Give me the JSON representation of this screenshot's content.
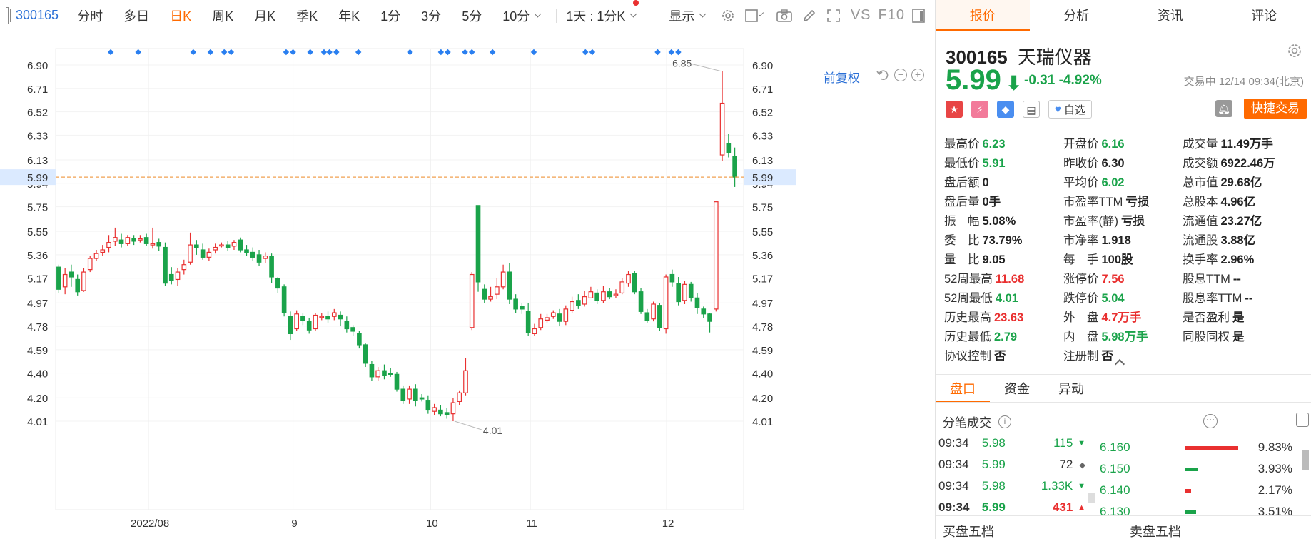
{
  "toolbar": {
    "code": "300165",
    "periods": [
      "分时",
      "多日",
      "日K",
      "周K",
      "月K",
      "季K",
      "年K",
      "1分",
      "3分",
      "5分"
    ],
    "active_period": "日K",
    "interval_select": "10分",
    "combo_select": "1天 : 1分K",
    "display_label": "显示",
    "vs_label": "VS",
    "f10_label": "F10"
  },
  "chart": {
    "adjust_label": "前复权",
    "reset_icon": "undo-icon",
    "zoom_out_icon": "minus-icon",
    "zoom_in_icon": "plus-icon",
    "current_price_label": "5.99",
    "high_label": "6.85",
    "low_label": "4.01",
    "x_labels": [
      "2022/08",
      "9",
      "10",
      "11",
      "12"
    ],
    "y_labels": [
      "6.90",
      "6.71",
      "6.52",
      "6.33",
      "6.13",
      "5.94",
      "5.75",
      "5.55",
      "5.36",
      "5.17",
      "4.97",
      "4.78",
      "4.59",
      "4.40",
      "4.20",
      "4.01"
    ]
  },
  "chart_data": {
    "type": "candlestick",
    "y_axis": {
      "ticks": [
        6.9,
        6.71,
        6.52,
        6.33,
        6.13,
        5.94,
        5.75,
        5.55,
        5.36,
        5.17,
        4.97,
        4.78,
        4.59,
        4.4,
        4.2,
        4.01
      ],
      "range": [
        4.01,
        6.9
      ]
    },
    "x_labels": [
      "2022/08",
      "9",
      "10",
      "11",
      "12"
    ],
    "current_price": 5.99,
    "max_label": 6.85,
    "min_label": 4.01,
    "candles": [
      [
        5.26,
        5.08,
        5.28,
        5.05
      ],
      [
        5.1,
        5.2,
        5.25,
        5.04
      ],
      [
        5.22,
        5.18,
        5.28,
        5.1
      ],
      [
        5.16,
        5.06,
        5.2,
        5.03
      ],
      [
        5.07,
        5.22,
        5.25,
        5.06
      ],
      [
        5.24,
        5.33,
        5.35,
        5.22
      ],
      [
        5.33,
        5.37,
        5.4,
        5.31
      ],
      [
        5.38,
        5.4,
        5.44,
        5.35
      ],
      [
        5.42,
        5.46,
        5.52,
        5.38
      ],
      [
        5.47,
        5.5,
        5.58,
        5.43
      ],
      [
        5.48,
        5.45,
        5.53,
        5.42
      ],
      [
        5.45,
        5.5,
        5.52,
        5.43
      ],
      [
        5.49,
        5.47,
        5.52,
        5.44
      ],
      [
        5.48,
        5.49,
        5.52,
        5.46
      ],
      [
        5.5,
        5.45,
        5.53,
        5.43
      ],
      [
        5.44,
        5.45,
        5.58,
        5.41
      ],
      [
        5.46,
        5.43,
        5.49,
        5.39
      ],
      [
        5.42,
        5.13,
        5.46,
        5.11
      ],
      [
        5.2,
        5.15,
        5.26,
        5.12
      ],
      [
        5.16,
        5.22,
        5.25,
        5.11
      ],
      [
        5.24,
        5.28,
        5.32,
        5.2
      ],
      [
        5.3,
        5.44,
        5.54,
        5.28
      ],
      [
        5.44,
        5.42,
        5.48,
        5.36
      ],
      [
        5.4,
        5.34,
        5.45,
        5.32
      ],
      [
        5.34,
        5.38,
        5.41,
        5.31
      ],
      [
        5.4,
        5.42,
        5.45,
        5.37
      ],
      [
        5.44,
        5.44,
        5.46,
        5.42
      ],
      [
        5.44,
        5.42,
        5.47,
        5.39
      ],
      [
        5.43,
        5.46,
        5.48,
        5.4
      ],
      [
        5.48,
        5.4,
        5.5,
        5.38
      ],
      [
        5.4,
        5.38,
        5.44,
        5.35
      ],
      [
        5.38,
        5.34,
        5.42,
        5.31
      ],
      [
        5.36,
        5.3,
        5.4,
        5.27
      ],
      [
        5.33,
        5.35,
        5.38,
        5.29
      ],
      [
        5.35,
        5.18,
        5.37,
        5.13
      ],
      [
        5.17,
        5.09,
        5.18,
        5.05
      ],
      [
        5.1,
        4.89,
        5.12,
        4.86
      ],
      [
        4.86,
        4.72,
        4.9,
        4.67
      ],
      [
        4.76,
        4.88,
        4.91,
        4.74
      ],
      [
        4.86,
        4.83,
        4.89,
        4.79
      ],
      [
        4.82,
        4.75,
        4.85,
        4.72
      ],
      [
        4.76,
        4.87,
        4.89,
        4.74
      ],
      [
        4.86,
        4.86,
        4.89,
        4.83
      ],
      [
        4.86,
        4.84,
        4.9,
        4.81
      ],
      [
        4.86,
        4.89,
        4.92,
        4.83
      ],
      [
        4.87,
        4.84,
        4.9,
        4.78
      ],
      [
        4.82,
        4.76,
        4.86,
        4.73
      ],
      [
        4.77,
        4.74,
        4.79,
        4.7
      ],
      [
        4.72,
        4.63,
        4.74,
        4.6
      ],
      [
        4.63,
        4.48,
        4.64,
        4.45
      ],
      [
        4.47,
        4.37,
        4.5,
        4.34
      ],
      [
        4.37,
        4.42,
        4.45,
        4.34
      ],
      [
        4.42,
        4.38,
        4.47,
        4.35
      ],
      [
        4.4,
        4.39,
        4.44,
        4.37
      ],
      [
        4.39,
        4.27,
        4.41,
        4.25
      ],
      [
        4.27,
        4.18,
        4.3,
        4.15
      ],
      [
        4.19,
        4.27,
        4.3,
        4.15
      ],
      [
        4.27,
        4.18,
        4.31,
        4.13
      ],
      [
        4.2,
        4.19,
        4.23,
        4.17
      ],
      [
        4.18,
        4.1,
        4.22,
        4.07
      ],
      [
        4.09,
        4.12,
        4.15,
        4.06
      ],
      [
        4.1,
        4.07,
        4.14,
        4.05
      ],
      [
        4.08,
        4.06,
        4.12,
        4.03
      ],
      [
        4.07,
        4.16,
        4.2,
        4.01
      ],
      [
        4.17,
        4.24,
        4.26,
        4.14
      ],
      [
        4.24,
        4.42,
        4.52,
        4.22
      ],
      [
        4.77,
        5.2,
        5.22,
        4.75
      ],
      [
        5.76,
        5.14,
        5.76,
        5.06
      ],
      [
        5.08,
        5.0,
        5.12,
        4.97
      ],
      [
        5.0,
        5.02,
        5.1,
        4.98
      ],
      [
        5.04,
        5.1,
        5.17,
        5.0
      ],
      [
        5.1,
        5.22,
        5.28,
        5.08
      ],
      [
        5.22,
        5.0,
        5.29,
        4.96
      ],
      [
        5.0,
        4.92,
        5.04,
        4.89
      ],
      [
        4.94,
        4.92,
        4.97,
        4.88
      ],
      [
        4.9,
        4.73,
        4.97,
        4.7
      ],
      [
        4.72,
        4.76,
        4.8,
        4.7
      ],
      [
        4.77,
        4.84,
        4.88,
        4.75
      ],
      [
        4.83,
        4.85,
        4.88,
        4.81
      ],
      [
        4.86,
        4.89,
        4.91,
        4.84
      ],
      [
        4.88,
        4.82,
        4.92,
        4.78
      ],
      [
        4.82,
        4.92,
        4.95,
        4.79
      ],
      [
        4.91,
        4.98,
        5.02,
        4.89
      ],
      [
        4.99,
        4.95,
        5.04,
        4.92
      ],
      [
        4.96,
        5.02,
        5.07,
        4.94
      ],
      [
        5.01,
        5.06,
        5.1,
        5.01
      ],
      [
        5.05,
        4.99,
        5.08,
        4.96
      ],
      [
        4.99,
        5.06,
        5.11,
        4.97
      ],
      [
        5.06,
        5.02,
        5.09,
        5.0
      ],
      [
        5.03,
        5.04,
        5.08,
        5.01
      ],
      [
        5.05,
        5.14,
        5.17,
        5.04
      ],
      [
        5.13,
        5.2,
        5.23,
        5.1
      ],
      [
        5.21,
        5.06,
        5.23,
        5.04
      ],
      [
        5.06,
        4.9,
        5.09,
        4.88
      ],
      [
        4.89,
        4.83,
        4.92,
        4.81
      ],
      [
        4.84,
        4.96,
        4.98,
        4.82
      ],
      [
        4.95,
        4.77,
        4.97,
        4.74
      ],
      [
        4.76,
        5.18,
        5.2,
        4.72
      ],
      [
        5.2,
        5.14,
        5.24,
        5.1
      ],
      [
        5.13,
        4.98,
        5.18,
        4.95
      ],
      [
        4.99,
        5.12,
        5.15,
        4.96
      ],
      [
        5.12,
        5.01,
        5.14,
        4.98
      ],
      [
        5.01,
        4.93,
        5.05,
        4.88
      ],
      [
        4.92,
        4.88,
        4.94,
        4.85
      ],
      [
        4.88,
        4.82,
        4.89,
        4.73
      ],
      [
        4.92,
        5.79,
        5.79,
        4.9
      ],
      [
        6.17,
        6.59,
        6.85,
        6.12
      ],
      [
        6.26,
        6.19,
        6.34,
        6.15
      ],
      [
        6.16,
        5.99,
        6.23,
        5.91
      ]
    ],
    "marker_positions": [
      0.08,
      0.12,
      0.2,
      0.225,
      0.245,
      0.255,
      0.335,
      0.345,
      0.37,
      0.39,
      0.398,
      0.408,
      0.44,
      0.515,
      0.56,
      0.57,
      0.595,
      0.605,
      0.635,
      0.695,
      0.77,
      0.78,
      0.875,
      0.895,
      0.905
    ]
  },
  "quote": {
    "tabs": [
      "报价",
      "分析",
      "资讯",
      "评论"
    ],
    "active_tab": "报价",
    "code": "300165",
    "name": "天瑞仪器",
    "price": "5.99",
    "change": "-0.31",
    "change_pct": "-4.92%",
    "status": "交易中 12/14 09:34(北京)",
    "watch_label": "自选",
    "quick_trade_label": "快捷交易",
    "stats": [
      [
        {
          "l": "最高价",
          "v": "6.23",
          "c": "green"
        },
        {
          "l": "开盘价",
          "v": "6.16",
          "c": "green"
        },
        {
          "l": "成交量",
          "v": "11.49万手",
          "c": "dark"
        }
      ],
      [
        {
          "l": "最低价",
          "v": "5.91",
          "c": "green"
        },
        {
          "l": "昨收价",
          "v": "6.30",
          "c": "dark"
        },
        {
          "l": "成交额",
          "v": "6922.46万",
          "c": "dark"
        }
      ],
      [
        {
          "l": "盘后额",
          "v": "0",
          "c": "dark"
        },
        {
          "l": "平均价",
          "v": "6.02",
          "c": "green"
        },
        {
          "l": "总市值",
          "v": "29.68亿",
          "c": "dark"
        }
      ],
      [
        {
          "l": "盘后量",
          "v": "0手",
          "c": "dark"
        },
        {
          "l": "市盈率TTM",
          "v": "亏损",
          "c": "dark"
        },
        {
          "l": "总股本",
          "v": "4.96亿",
          "c": "dark"
        }
      ],
      [
        {
          "l": "振　幅",
          "v": "5.08%",
          "c": "dark"
        },
        {
          "l": "市盈率(静)",
          "v": "亏损",
          "c": "dark"
        },
        {
          "l": "流通值",
          "v": "23.27亿",
          "c": "dark"
        }
      ],
      [
        {
          "l": "委　比",
          "v": "73.79%",
          "c": "dark"
        },
        {
          "l": "市净率",
          "v": "1.918",
          "c": "dark"
        },
        {
          "l": "流通股",
          "v": "3.88亿",
          "c": "dark"
        }
      ],
      [
        {
          "l": "量　比",
          "v": "9.05",
          "c": "dark"
        },
        {
          "l": "每　手",
          "v": "100股",
          "c": "dark"
        },
        {
          "l": "换手率",
          "v": "2.96%",
          "c": "dark"
        }
      ],
      [
        {
          "l": "52周最高",
          "v": "11.68",
          "c": "red"
        },
        {
          "l": "涨停价",
          "v": "7.56",
          "c": "red"
        },
        {
          "l": "股息TTM",
          "v": "--",
          "c": "dark"
        }
      ],
      [
        {
          "l": "52周最低",
          "v": "4.01",
          "c": "green"
        },
        {
          "l": "跌停价",
          "v": "5.04",
          "c": "green"
        },
        {
          "l": "股息率TTM",
          "v": "--",
          "c": "dark"
        }
      ],
      [
        {
          "l": "历史最高",
          "v": "23.63",
          "c": "red"
        },
        {
          "l": "外　盘",
          "v": "4.7万手",
          "c": "red"
        },
        {
          "l": "是否盈利",
          "v": "是",
          "c": "dark"
        }
      ],
      [
        {
          "l": "历史最低",
          "v": "2.79",
          "c": "green"
        },
        {
          "l": "内　盘",
          "v": "5.98万手",
          "c": "green"
        },
        {
          "l": "同股同权",
          "v": "是",
          "c": "dark"
        }
      ],
      [
        {
          "l": "协议控制",
          "v": "否",
          "c": "dark"
        },
        {
          "l": "注册制",
          "v": "否",
          "c": "dark"
        },
        {
          "l": "",
          "v": "",
          "c": "dark"
        }
      ]
    ]
  },
  "market": {
    "subtabs": [
      "盘口",
      "资金",
      "异动"
    ],
    "active_subtab": "盘口",
    "trades_title": "分笔成交",
    "trades": [
      {
        "t": "09:34",
        "p": "5.98",
        "v": "115",
        "d": "▼",
        "c": "green",
        "b": false
      },
      {
        "t": "09:34",
        "p": "5.99",
        "v": "72",
        "d": "◆",
        "c": "grey",
        "b": false
      },
      {
        "t": "09:34",
        "p": "5.98",
        "v": "1.33K",
        "d": "▼",
        "c": "green",
        "b": false
      },
      {
        "t": "09:34",
        "p": "5.99",
        "v": "431",
        "d": "▲",
        "c": "red",
        "b": true
      }
    ],
    "depth": [
      {
        "p": "6.160",
        "pct": "9.83%",
        "w": 98,
        "c": "#e93030"
      },
      {
        "p": "6.150",
        "pct": "3.93%",
        "w": 22,
        "c": "#1aa34a"
      },
      {
        "p": "6.140",
        "pct": "2.17%",
        "w": 10,
        "c": "#e93030"
      },
      {
        "p": "6.130",
        "pct": "3.51%",
        "w": 20,
        "c": "#1aa34a"
      }
    ],
    "buy5_title": "买盘五档",
    "sell5_title": "卖盘五档"
  },
  "colors": {
    "up": "#e93030",
    "down": "#1aa34a",
    "accent": "#ff6a00",
    "link": "#2a6fd6",
    "marker": "#2a7ff0"
  }
}
